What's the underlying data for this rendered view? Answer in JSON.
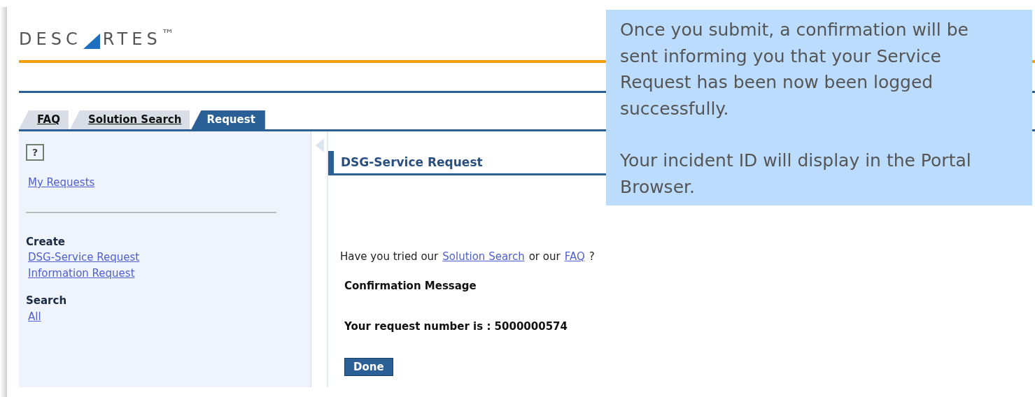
{
  "logo": {
    "left": "DESC",
    "right": "RTES$^{™}$"
  },
  "tabs": [
    {
      "label": "FAQ",
      "selected": false
    },
    {
      "label": "Solution Search",
      "selected": false
    },
    {
      "label": "Request",
      "selected": true
    }
  ],
  "sidebar": {
    "help": "?",
    "my_requests": "My Requests",
    "sections": [
      {
        "title": "Create",
        "links": [
          "DSG-Service Request",
          "Information Request"
        ]
      },
      {
        "title": "Search",
        "links": [
          "All"
        ]
      }
    ]
  },
  "content": {
    "title": "DSG-Service Request",
    "prompt": {
      "before": "Have you tried our",
      "link1": "Solution Search ",
      "middle": "or our",
      "link2": "FAQ ",
      "after": "?"
    },
    "message_title": "Confirmation Message",
    "request_number": "Your request number is : 5000000574",
    "done_button": "Done"
  },
  "callout": {
    "paragraphs": [
      "Once you submit, a confirmation will be sent informing you that your Service Request has been now been logged successfully.",
      "Your incident ID will display in the Portal Browser."
    ]
  }
}
